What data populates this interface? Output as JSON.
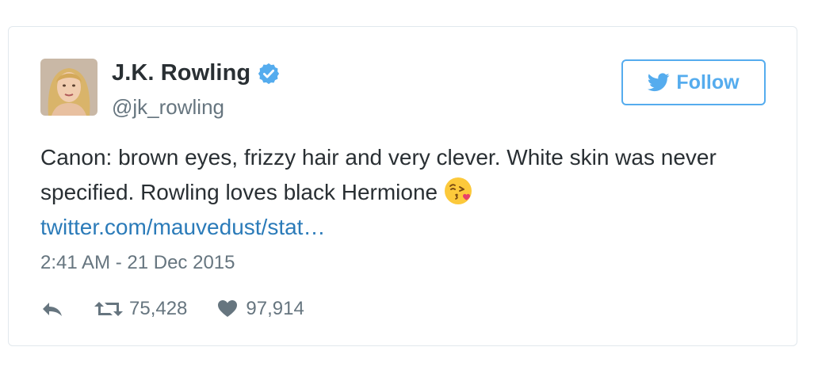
{
  "tweet": {
    "author_name": "J.K. Rowling",
    "handle": "@jk_rowling",
    "follow_label": "Follow",
    "text": "Canon: brown eyes, frizzy hair and very clever. White skin was never specified. Rowling loves black Hermione",
    "emoji": "face-throwing-kiss-emoji",
    "link_text": "twitter.com/mauvedust/stat…",
    "timestamp": "2:41 AM - 21 Dec 2015",
    "retweets": "75,428",
    "likes": "97,914"
  },
  "icons": {
    "verified": "verified-badge-icon",
    "bird": "twitter-bird-icon",
    "reply": "reply-icon",
    "retweet": "retweet-icon",
    "like": "heart-icon"
  },
  "colors": {
    "accent": "#55acee",
    "link": "#2b7bb9",
    "text": "#292f33",
    "muted": "#66757f",
    "border": "#e1e8ed"
  }
}
